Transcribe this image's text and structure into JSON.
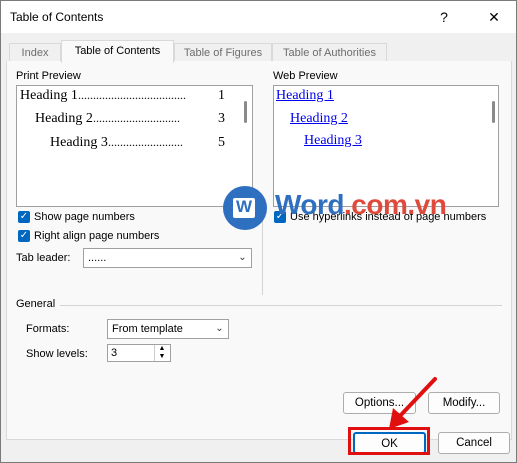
{
  "window": {
    "title": "Table of Contents",
    "help_glyph": "?",
    "close_glyph": "✕"
  },
  "tabs": [
    {
      "label": "Index"
    },
    {
      "label": "Table of Contents"
    },
    {
      "label": "Table of Figures"
    },
    {
      "label": "Table of Authorities"
    }
  ],
  "print_preview": {
    "label": "Print Preview",
    "entries": [
      {
        "text": "Heading 1",
        "dots": "....................................",
        "page": "1"
      },
      {
        "text": "Heading 2",
        "dots": ".............................",
        "page": "3"
      },
      {
        "text": "Heading 3",
        "dots": ".........................",
        "page": "5"
      }
    ]
  },
  "web_preview": {
    "label": "Web Preview",
    "entries": [
      "Heading 1",
      "Heading 2",
      "Heading 3"
    ]
  },
  "options": {
    "show_page_numbers": {
      "label": "Show page numbers",
      "checked": true
    },
    "right_align": {
      "label": "Right align page numbers",
      "checked": true
    },
    "use_hyperlinks": {
      "label": "Use hyperlinks instead of page numbers",
      "checked": true
    },
    "tab_leader": {
      "label": "Tab leader:",
      "value": "......"
    }
  },
  "general": {
    "label": "General",
    "formats_label": "Formats:",
    "formats_value": "From template",
    "levels_label": "Show levels:",
    "levels_value": "3"
  },
  "buttons": {
    "options": "Options...",
    "modify": "Modify...",
    "ok": "OK",
    "cancel": "Cancel"
  },
  "watermark": {
    "brand_blue": "Word",
    "brand_red": ".com.vn",
    "letter": "W"
  },
  "colors": {
    "accent": "#0067c0",
    "highlight_red": "#e01010",
    "link": "#0000ee"
  }
}
